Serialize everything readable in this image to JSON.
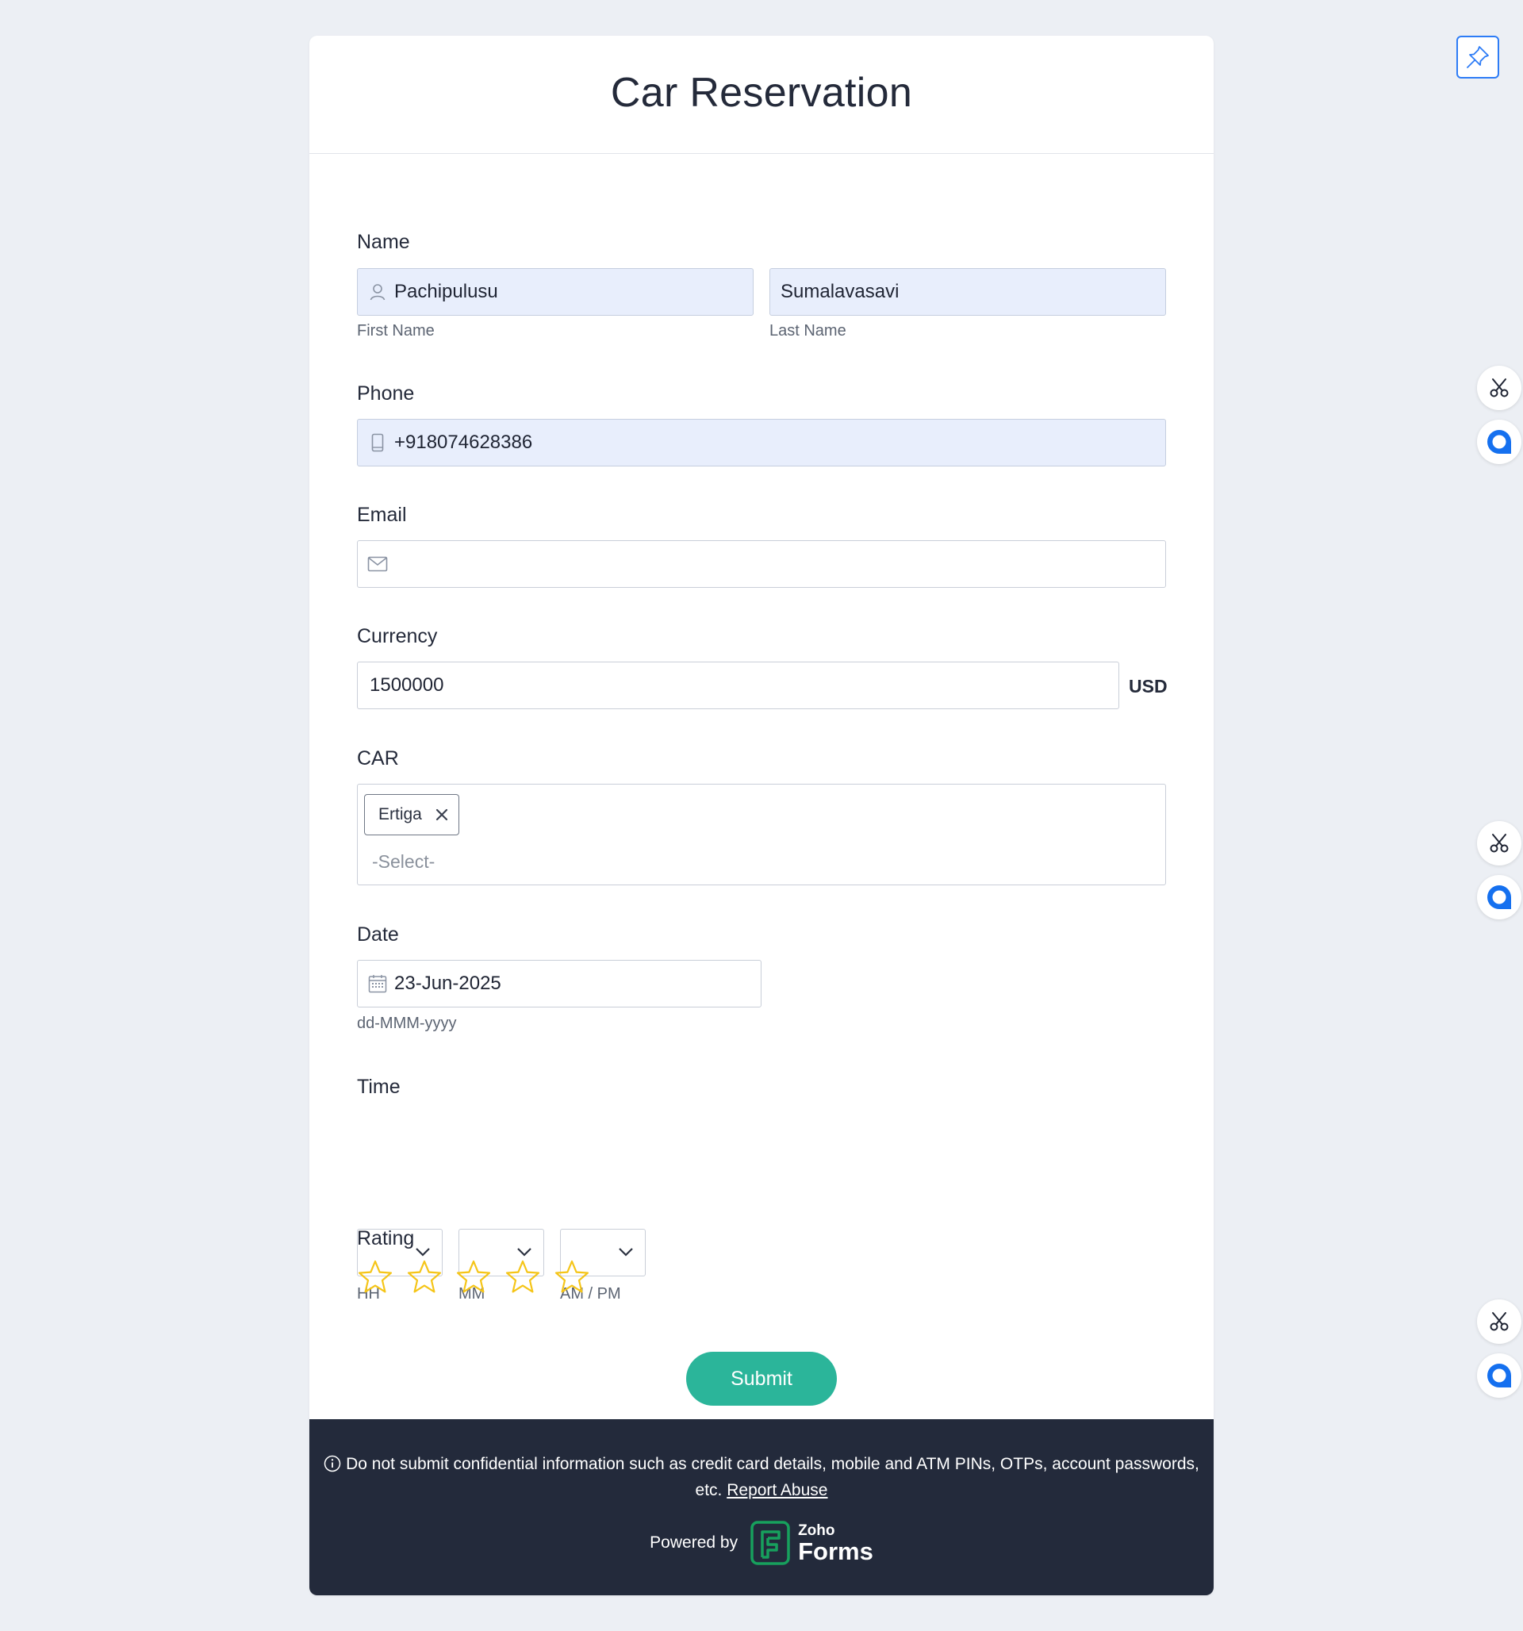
{
  "form": {
    "title": "Car Reservation",
    "name": {
      "label": "Name",
      "first_value": "Pachipulusu",
      "first_sub": "First Name",
      "last_value": "Sumalavasavi",
      "last_sub": "Last Name"
    },
    "phone": {
      "label": "Phone",
      "value": "+918074628386"
    },
    "email": {
      "label": "Email",
      "value": ""
    },
    "currency": {
      "label": "Currency",
      "value": "1500000",
      "unit": "USD"
    },
    "car": {
      "label": "CAR",
      "selected_chip": "Ertiga",
      "placeholder": "-Select-"
    },
    "date": {
      "label": "Date",
      "value": "23-Jun-2025",
      "format_hint": "dd-MMM-yyyy"
    },
    "time": {
      "label": "Time",
      "hh_sub": "HH",
      "mm_sub": "MM",
      "ampm_sub": "AM / PM"
    },
    "rating": {
      "label": "Rating",
      "max": 5,
      "value": 0
    },
    "submit_label": "Submit"
  },
  "footer": {
    "notice": "Do not submit confidential information such as credit card details, mobile and ATM PINs, OTPs, account passwords, etc.",
    "report_link": "Report Abuse",
    "powered_by": "Powered by",
    "brand_top": "Zoho",
    "brand_bottom": "Forms"
  },
  "icons": {
    "name": "person-icon",
    "phone": "phone-icon",
    "email": "envelope-icon",
    "date": "calendar-icon",
    "star": "star-outline-icon",
    "pin": "pin-icon",
    "scissors": "scissors-icon",
    "chat": "chat-bubble-icon"
  },
  "colors": {
    "accent": "#2bb59a",
    "star": "#f5c518",
    "footer_bg": "#232a3b",
    "filled_input_bg": "#e8eefc",
    "side_blue": "#1570ef"
  }
}
